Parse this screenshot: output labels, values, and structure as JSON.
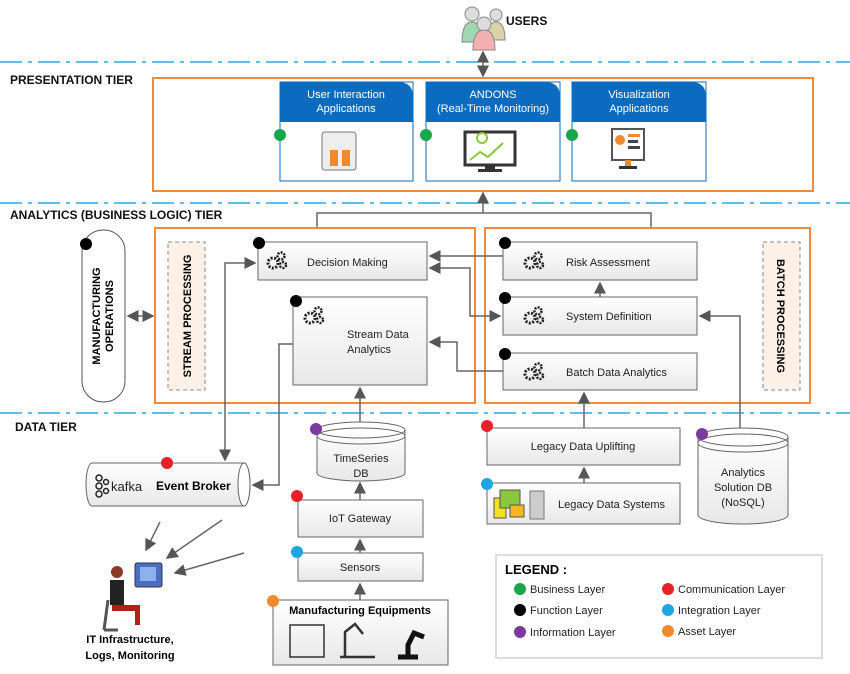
{
  "colors": {
    "tier_divider": "#29a8e0",
    "tier_box": "#f08a3c",
    "card_header": "#0a6bbf",
    "business": "#1aa64a",
    "function": "#000000",
    "information": "#7a3b9c",
    "communication": "#e8202a",
    "integration": "#1fa6e0",
    "asset": "#ef8a2e"
  },
  "users": {
    "label": "USERS",
    "icon": "users-icon"
  },
  "tiers": {
    "presentation": "PRESENTATION TIER",
    "analytics": "ANALYTICS (BUSINESS LOGIC) TIER",
    "data": "DATA TIER"
  },
  "presentation": {
    "cards": [
      {
        "line1": "User Interaction",
        "line2": "Applications",
        "icon": "keyboard-hands-icon"
      },
      {
        "line1": "ANDONS",
        "line2": "(Real-Time Monitoring)",
        "icon": "monitor-chart-icon"
      },
      {
        "line1": "Visualization",
        "line2": "Applications",
        "icon": "dashboard-monitor-icon"
      }
    ]
  },
  "analytics": {
    "manufacturing_operations": {
      "line1": "MANUFACTURING",
      "line2": "OPERATIONS"
    },
    "stream_processing": "STREAM PROCESSING",
    "batch_processing": "BATCH PROCESSING",
    "decision_making": "Decision Making",
    "stream_data_analytics": {
      "line1": "Stream Data",
      "line2": "Analytics"
    },
    "risk_assessment": "Risk Assessment",
    "system_definition": "System Definition",
    "batch_data_analytics": "Batch Data Analytics"
  },
  "data_tier": {
    "event_broker": {
      "brand": "kafka",
      "label": "Event Broker"
    },
    "timeseries_db": {
      "line1": "TimeSeries",
      "line2": "DB"
    },
    "iot_gateway": "IoT Gateway",
    "sensors": "Sensors",
    "manufacturing_equipments": "Manufacturing Equipments",
    "legacy_data_uplifting": "Legacy Data Uplifting",
    "legacy_data_systems": "Legacy Data Systems",
    "analytics_solution_db": {
      "line1": "Analytics",
      "line2": "Solution DB",
      "line3": "(NoSQL)"
    },
    "it_infrastructure": {
      "line1": "IT Infrastructure,",
      "line2": "Logs,  Monitoring"
    }
  },
  "legend": {
    "title": "LEGEND :",
    "items": [
      {
        "label": "Business Layer",
        "color": "#1aa64a"
      },
      {
        "label": "Function Layer",
        "color": "#000000"
      },
      {
        "label": "Information Layer",
        "color": "#7a3b9c"
      },
      {
        "label": "Communication Layer",
        "color": "#e8202a"
      },
      {
        "label": "Integration Layer",
        "color": "#1fa6e0"
      },
      {
        "label": "Asset Layer",
        "color": "#ef8a2e"
      }
    ]
  }
}
